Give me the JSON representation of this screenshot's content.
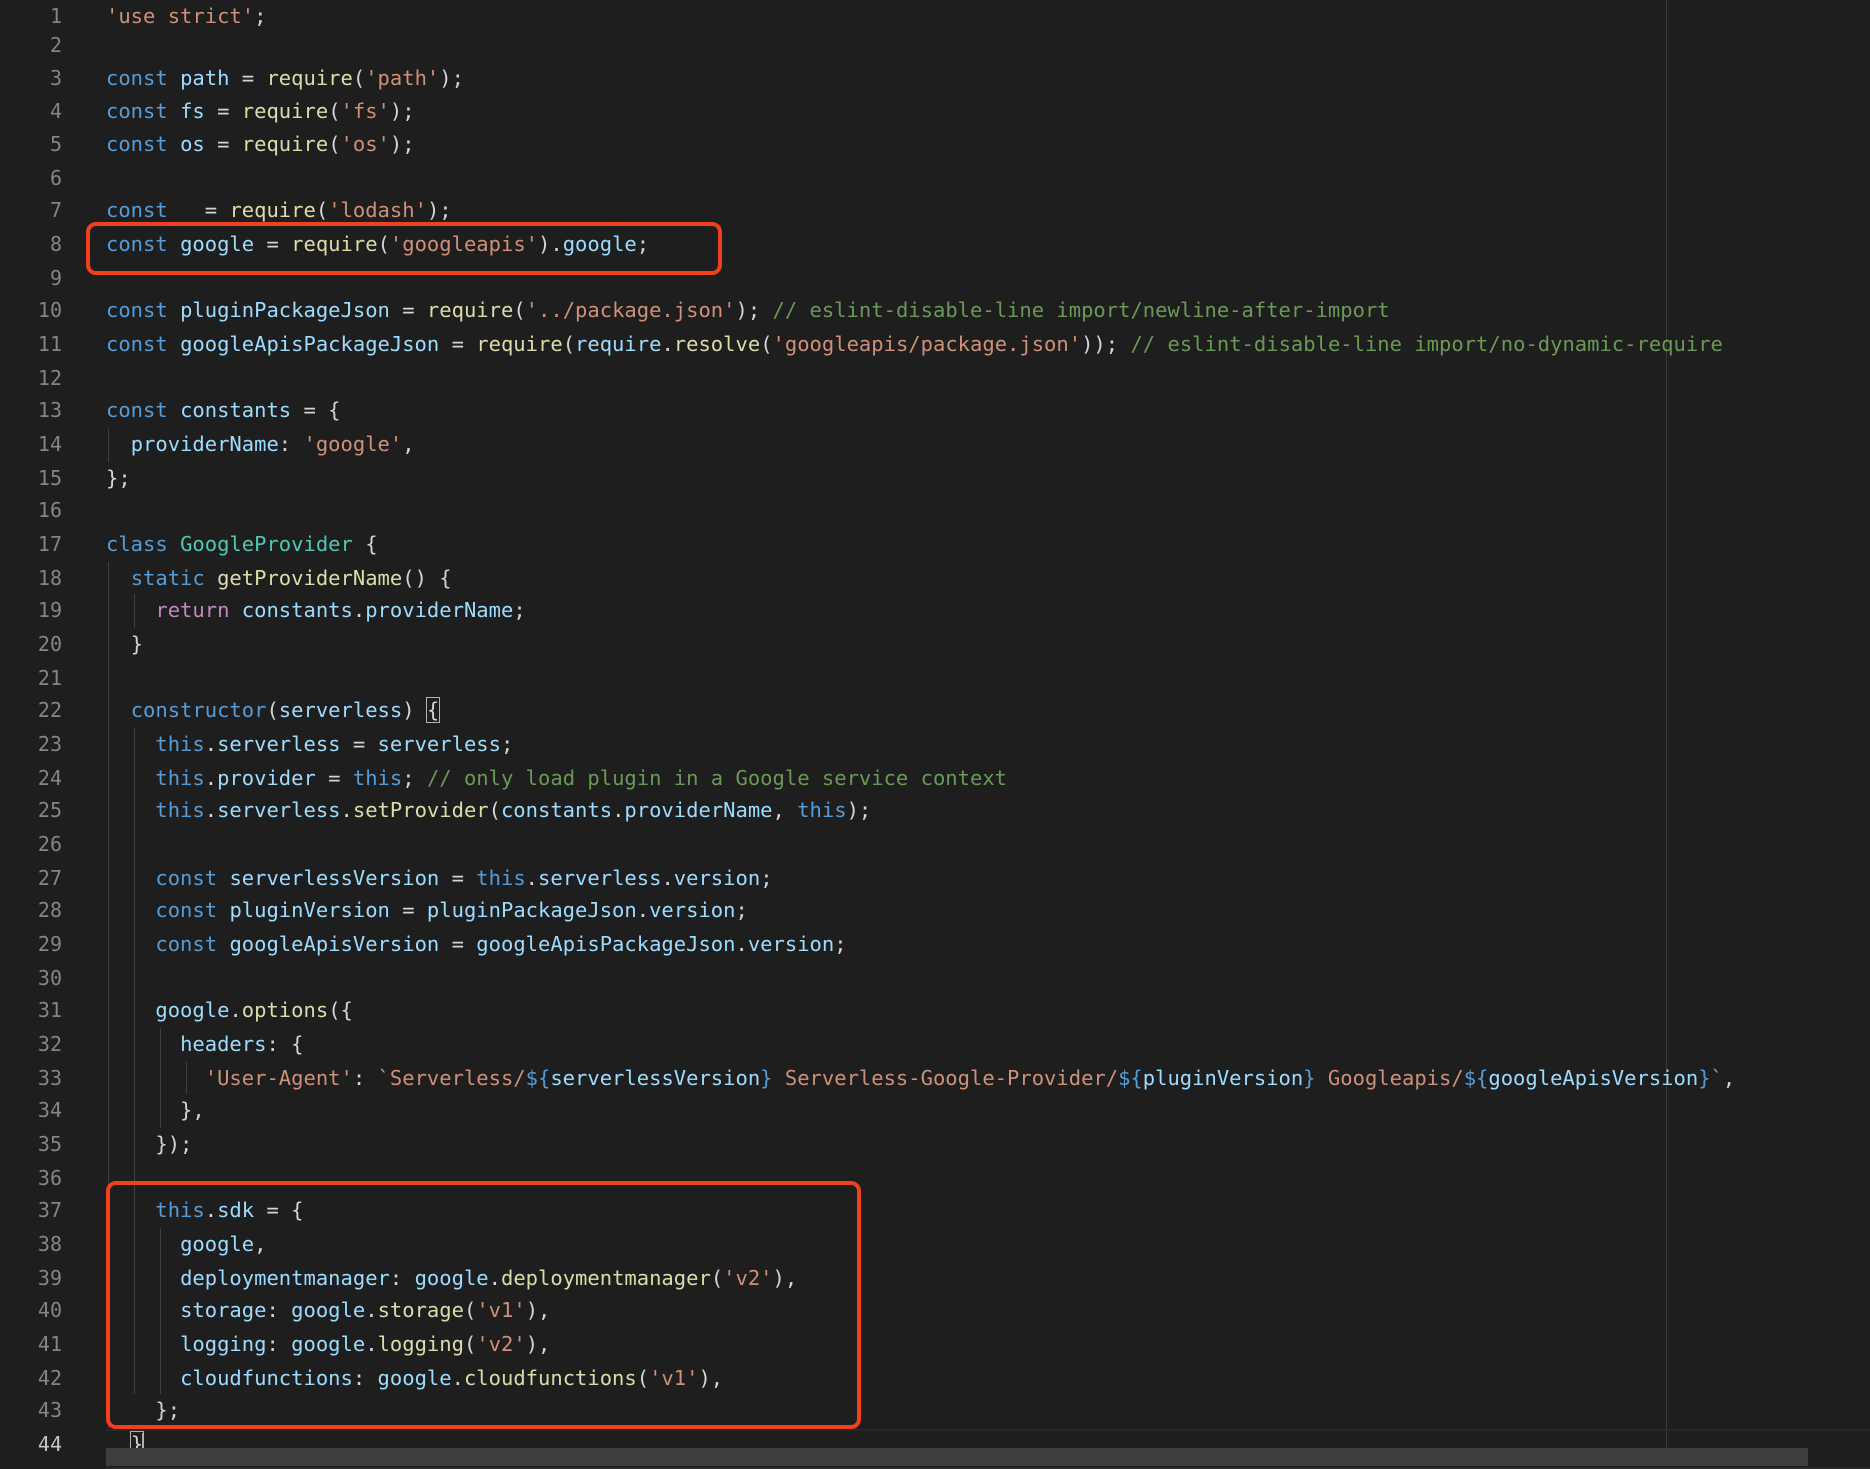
{
  "editor": {
    "line_numbers": [
      "1",
      "2",
      "3",
      "4",
      "5",
      "6",
      "7",
      "8",
      "9",
      "10",
      "11",
      "12",
      "13",
      "14",
      "15",
      "16",
      "17",
      "18",
      "19",
      "20",
      "21",
      "22",
      "23",
      "24",
      "25",
      "26",
      "27",
      "28",
      "29",
      "30",
      "31",
      "32",
      "33",
      "34",
      "35",
      "36",
      "37",
      "38",
      "39",
      "40",
      "41",
      "42",
      "43",
      "44"
    ],
    "lines": [
      [
        {
          "t": "'use strict'",
          "c": "str"
        },
        {
          "t": ";",
          "c": "p"
        }
      ],
      [],
      [
        {
          "t": "const",
          "c": "kw"
        },
        {
          "t": " "
        },
        {
          "t": "path",
          "c": "var"
        },
        {
          "t": " = "
        },
        {
          "t": "require",
          "c": "fn"
        },
        {
          "t": "("
        },
        {
          "t": "'path'",
          "c": "str"
        },
        {
          "t": ");"
        }
      ],
      [
        {
          "t": "const",
          "c": "kw"
        },
        {
          "t": " "
        },
        {
          "t": "fs",
          "c": "var"
        },
        {
          "t": " = "
        },
        {
          "t": "require",
          "c": "fn"
        },
        {
          "t": "("
        },
        {
          "t": "'fs'",
          "c": "str"
        },
        {
          "t": ");"
        }
      ],
      [
        {
          "t": "const",
          "c": "kw"
        },
        {
          "t": " "
        },
        {
          "t": "os",
          "c": "var"
        },
        {
          "t": " = "
        },
        {
          "t": "require",
          "c": "fn"
        },
        {
          "t": "("
        },
        {
          "t": "'os'",
          "c": "str"
        },
        {
          "t": ");"
        }
      ],
      [],
      [
        {
          "t": "const",
          "c": "kw"
        },
        {
          "t": "   = "
        },
        {
          "t": "require",
          "c": "fn"
        },
        {
          "t": "("
        },
        {
          "t": "'lodash'",
          "c": "str"
        },
        {
          "t": ");"
        }
      ],
      [
        {
          "t": "const",
          "c": "kw"
        },
        {
          "t": " "
        },
        {
          "t": "google",
          "c": "var"
        },
        {
          "t": " = "
        },
        {
          "t": "require",
          "c": "fn"
        },
        {
          "t": "("
        },
        {
          "t": "'googleapis'",
          "c": "str"
        },
        {
          "t": ")."
        },
        {
          "t": "google",
          "c": "var"
        },
        {
          "t": ";"
        }
      ],
      [],
      [
        {
          "t": "const",
          "c": "kw"
        },
        {
          "t": " "
        },
        {
          "t": "pluginPackageJson",
          "c": "var"
        },
        {
          "t": " = "
        },
        {
          "t": "require",
          "c": "fn"
        },
        {
          "t": "("
        },
        {
          "t": "'../package.json'",
          "c": "str"
        },
        {
          "t": "); "
        },
        {
          "t": "// eslint-disable-line import/newline-after-import",
          "c": "cm"
        }
      ],
      [
        {
          "t": "const",
          "c": "kw"
        },
        {
          "t": " "
        },
        {
          "t": "googleApisPackageJson",
          "c": "var"
        },
        {
          "t": " = "
        },
        {
          "t": "require",
          "c": "fn"
        },
        {
          "t": "("
        },
        {
          "t": "require",
          "c": "var"
        },
        {
          "t": "."
        },
        {
          "t": "resolve",
          "c": "fn"
        },
        {
          "t": "("
        },
        {
          "t": "'googleapis/package.json'",
          "c": "str"
        },
        {
          "t": ")); "
        },
        {
          "t": "// eslint-disable-line import/no-dynamic-require",
          "c": "cm"
        }
      ],
      [],
      [
        {
          "t": "const",
          "c": "kw"
        },
        {
          "t": " "
        },
        {
          "t": "constants",
          "c": "var"
        },
        {
          "t": " = {"
        }
      ],
      [
        {
          "t": "  "
        },
        {
          "t": "providerName",
          "c": "var"
        },
        {
          "t": ": "
        },
        {
          "t": "'google'",
          "c": "str"
        },
        {
          "t": ","
        }
      ],
      [
        {
          "t": "};"
        }
      ],
      [],
      [
        {
          "t": "class",
          "c": "kw"
        },
        {
          "t": " "
        },
        {
          "t": "GoogleProvider",
          "c": "cls"
        },
        {
          "t": " {"
        }
      ],
      [
        {
          "t": "  "
        },
        {
          "t": "static",
          "c": "kw"
        },
        {
          "t": " "
        },
        {
          "t": "getProviderName",
          "c": "fn"
        },
        {
          "t": "() {"
        }
      ],
      [
        {
          "t": "    "
        },
        {
          "t": "return",
          "c": "ctl"
        },
        {
          "t": " "
        },
        {
          "t": "constants",
          "c": "var"
        },
        {
          "t": "."
        },
        {
          "t": "providerName",
          "c": "var"
        },
        {
          "t": ";"
        }
      ],
      [
        {
          "t": "  }"
        }
      ],
      [],
      [
        {
          "t": "  "
        },
        {
          "t": "constructor",
          "c": "kw"
        },
        {
          "t": "("
        },
        {
          "t": "serverless",
          "c": "var"
        },
        {
          "t": ") "
        },
        {
          "t": "{",
          "c": "p brk"
        }
      ],
      [
        {
          "t": "    "
        },
        {
          "t": "this",
          "c": "kw"
        },
        {
          "t": "."
        },
        {
          "t": "serverless",
          "c": "var"
        },
        {
          "t": " = "
        },
        {
          "t": "serverless",
          "c": "var"
        },
        {
          "t": ";"
        }
      ],
      [
        {
          "t": "    "
        },
        {
          "t": "this",
          "c": "kw"
        },
        {
          "t": "."
        },
        {
          "t": "provider",
          "c": "var"
        },
        {
          "t": " = "
        },
        {
          "t": "this",
          "c": "kw"
        },
        {
          "t": "; "
        },
        {
          "t": "// only load plugin in a Google service context",
          "c": "cm"
        }
      ],
      [
        {
          "t": "    "
        },
        {
          "t": "this",
          "c": "kw"
        },
        {
          "t": "."
        },
        {
          "t": "serverless",
          "c": "var"
        },
        {
          "t": "."
        },
        {
          "t": "setProvider",
          "c": "fn"
        },
        {
          "t": "("
        },
        {
          "t": "constants",
          "c": "var"
        },
        {
          "t": "."
        },
        {
          "t": "providerName",
          "c": "var"
        },
        {
          "t": ", "
        },
        {
          "t": "this",
          "c": "kw"
        },
        {
          "t": ");"
        }
      ],
      [],
      [
        {
          "t": "    "
        },
        {
          "t": "const",
          "c": "kw"
        },
        {
          "t": " "
        },
        {
          "t": "serverlessVersion",
          "c": "var"
        },
        {
          "t": " = "
        },
        {
          "t": "this",
          "c": "kw"
        },
        {
          "t": "."
        },
        {
          "t": "serverless",
          "c": "var"
        },
        {
          "t": "."
        },
        {
          "t": "version",
          "c": "var"
        },
        {
          "t": ";"
        }
      ],
      [
        {
          "t": "    "
        },
        {
          "t": "const",
          "c": "kw"
        },
        {
          "t": " "
        },
        {
          "t": "pluginVersion",
          "c": "var"
        },
        {
          "t": " = "
        },
        {
          "t": "pluginPackageJson",
          "c": "var"
        },
        {
          "t": "."
        },
        {
          "t": "version",
          "c": "var"
        },
        {
          "t": ";"
        }
      ],
      [
        {
          "t": "    "
        },
        {
          "t": "const",
          "c": "kw"
        },
        {
          "t": " "
        },
        {
          "t": "googleApisVersion",
          "c": "var"
        },
        {
          "t": " = "
        },
        {
          "t": "googleApisPackageJson",
          "c": "var"
        },
        {
          "t": "."
        },
        {
          "t": "version",
          "c": "var"
        },
        {
          "t": ";"
        }
      ],
      [],
      [
        {
          "t": "    "
        },
        {
          "t": "google",
          "c": "var"
        },
        {
          "t": "."
        },
        {
          "t": "options",
          "c": "fn"
        },
        {
          "t": "({"
        }
      ],
      [
        {
          "t": "      "
        },
        {
          "t": "headers",
          "c": "var"
        },
        {
          "t": ": {"
        }
      ],
      [
        {
          "t": "        "
        },
        {
          "t": "'User-Agent'",
          "c": "str"
        },
        {
          "t": ": "
        },
        {
          "t": "`Serverless/",
          "c": "str"
        },
        {
          "t": "${",
          "c": "kw"
        },
        {
          "t": "serverlessVersion",
          "c": "var"
        },
        {
          "t": "}",
          "c": "kw"
        },
        {
          "t": " Serverless-Google-Provider/",
          "c": "str"
        },
        {
          "t": "${",
          "c": "kw"
        },
        {
          "t": "pluginVersion",
          "c": "var"
        },
        {
          "t": "}",
          "c": "kw"
        },
        {
          "t": " Googleapis/",
          "c": "str"
        },
        {
          "t": "${",
          "c": "kw"
        },
        {
          "t": "googleApisVersion",
          "c": "var"
        },
        {
          "t": "}",
          "c": "kw"
        },
        {
          "t": "`",
          "c": "str"
        },
        {
          "t": ","
        }
      ],
      [
        {
          "t": "      },"
        }
      ],
      [
        {
          "t": "    });"
        }
      ],
      [],
      [
        {
          "t": "    "
        },
        {
          "t": "this",
          "c": "kw"
        },
        {
          "t": "."
        },
        {
          "t": "sdk",
          "c": "var"
        },
        {
          "t": " = {"
        }
      ],
      [
        {
          "t": "      "
        },
        {
          "t": "google",
          "c": "var"
        },
        {
          "t": ","
        }
      ],
      [
        {
          "t": "      "
        },
        {
          "t": "deploymentmanager",
          "c": "var"
        },
        {
          "t": ": "
        },
        {
          "t": "google",
          "c": "var"
        },
        {
          "t": "."
        },
        {
          "t": "deploymentmanager",
          "c": "fn"
        },
        {
          "t": "("
        },
        {
          "t": "'v2'",
          "c": "str"
        },
        {
          "t": "),"
        }
      ],
      [
        {
          "t": "      "
        },
        {
          "t": "storage",
          "c": "var"
        },
        {
          "t": ": "
        },
        {
          "t": "google",
          "c": "var"
        },
        {
          "t": "."
        },
        {
          "t": "storage",
          "c": "fn"
        },
        {
          "t": "("
        },
        {
          "t": "'v1'",
          "c": "str"
        },
        {
          "t": "),"
        }
      ],
      [
        {
          "t": "      "
        },
        {
          "t": "logging",
          "c": "var"
        },
        {
          "t": ": "
        },
        {
          "t": "google",
          "c": "var"
        },
        {
          "t": "."
        },
        {
          "t": "logging",
          "c": "fn"
        },
        {
          "t": "("
        },
        {
          "t": "'v2'",
          "c": "str"
        },
        {
          "t": "),"
        }
      ],
      [
        {
          "t": "      "
        },
        {
          "t": "cloudfunctions",
          "c": "var"
        },
        {
          "t": ": "
        },
        {
          "t": "google",
          "c": "var"
        },
        {
          "t": "."
        },
        {
          "t": "cloudfunctions",
          "c": "fn"
        },
        {
          "t": "("
        },
        {
          "t": "'v1'",
          "c": "str"
        },
        {
          "t": "),"
        }
      ],
      [
        {
          "t": "    };"
        }
      ],
      [
        {
          "t": "  "
        },
        {
          "t": "}",
          "c": "p brk"
        }
      ]
    ],
    "colors": {
      "background": "#1e1e1e",
      "keyword": "#569cd6",
      "string": "#ce9178",
      "comment": "#6a9955",
      "function": "#dcdcaa",
      "variable": "#9cdcfe",
      "class": "#4ec9b0",
      "control": "#c586c0",
      "annotation_box": "#f0401e"
    }
  }
}
